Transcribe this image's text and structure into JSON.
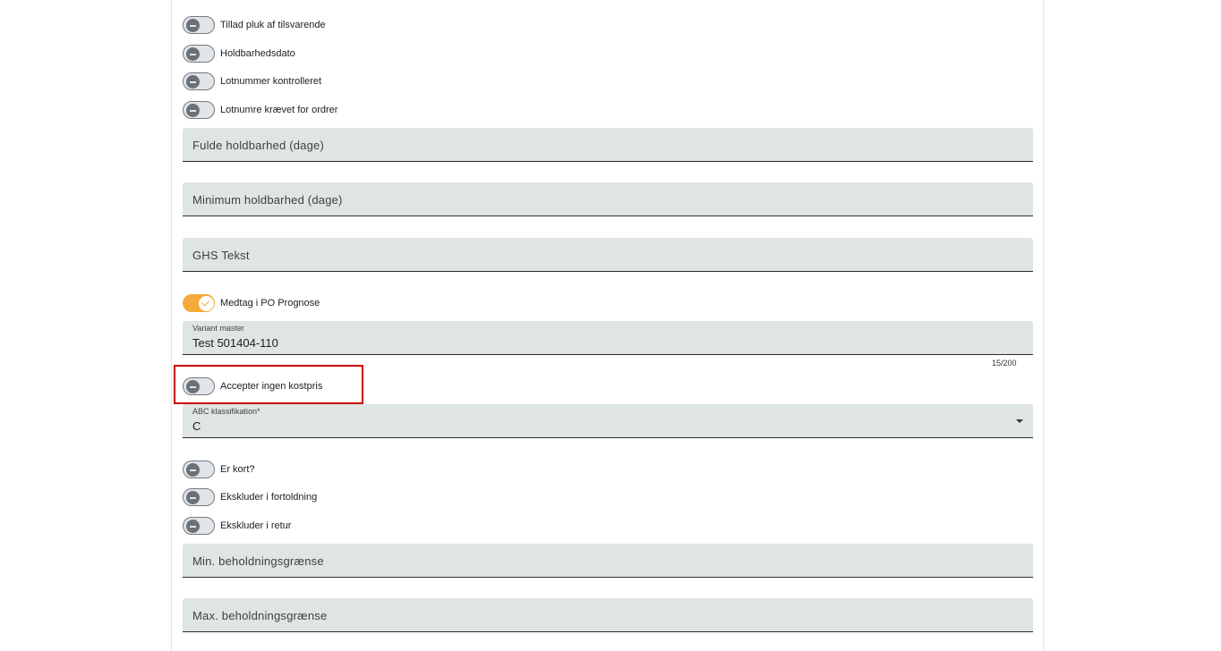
{
  "toggles_top": [
    {
      "label": "Tillad pluk af tilsvarende",
      "checked": false
    },
    {
      "label": "Holdbarhedsdato",
      "checked": false
    },
    {
      "label": "Lotnummer kontrolleret",
      "checked": false
    },
    {
      "label": "Lotnumre krævet for ordrer",
      "checked": false
    }
  ],
  "fields": {
    "full_shelf_life": {
      "placeholder": "Fulde holdbarhed (dage)"
    },
    "min_shelf_life": {
      "placeholder": "Minimum holdbarhed (dage)"
    },
    "ghs_text": {
      "placeholder": "GHS Tekst"
    },
    "variant_master": {
      "label": "Variant master",
      "value": "Test 501404-110",
      "counter": "15/200"
    },
    "abc_class": {
      "label": "ABC klassifikation*",
      "value": "C"
    },
    "min_stock": {
      "placeholder": "Min. beholdningsgrænse"
    },
    "max_stock": {
      "placeholder": "Max. beholdningsgrænse"
    }
  },
  "toggle_po_forecast": {
    "label": "Medtag i PO Prognose",
    "checked": true
  },
  "toggle_accept_no_cost": {
    "label": "Accepter ingen kostpris",
    "checked": false
  },
  "toggles_bottom": [
    {
      "label": "Er kort?",
      "checked": false
    },
    {
      "label": "Ekskluder i fortoldning",
      "checked": false
    },
    {
      "label": "Ekskluder i retur",
      "checked": false
    }
  ],
  "colors": {
    "accent": "#f6a93b",
    "field_bg": "#dfe5e5",
    "highlight": "#cc0000"
  }
}
